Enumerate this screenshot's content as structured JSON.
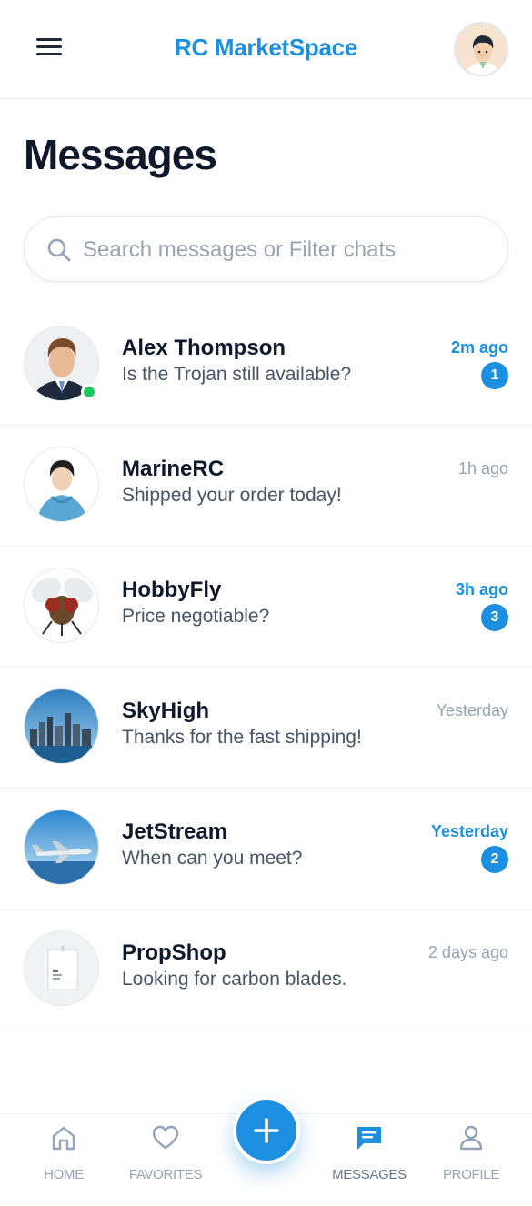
{
  "header": {
    "app_title": "RC MarketSpace"
  },
  "page": {
    "title": "Messages"
  },
  "search": {
    "placeholder": "Search messages or Filter chats",
    "value": ""
  },
  "chats": [
    {
      "name": "Alex Thompson",
      "message": "Is the Trojan still available?",
      "time": "2m ago",
      "unread": "1",
      "online": true
    },
    {
      "name": "MarineRC",
      "message": "Shipped your order today!",
      "time": "1h ago",
      "unread": ""
    },
    {
      "name": "HobbyFly",
      "message": "Price negotiable?",
      "time": "3h ago",
      "unread": "3"
    },
    {
      "name": "SkyHigh",
      "message": "Thanks for the fast shipping!",
      "time": "Yesterday",
      "unread": ""
    },
    {
      "name": "JetStream",
      "message": "When can you meet?",
      "time": "Yesterday",
      "unread": "2"
    },
    {
      "name": "PropShop",
      "message": "Looking for carbon blades.",
      "time": "2 days ago",
      "unread": ""
    }
  ],
  "bottom_nav": {
    "home": "HOME",
    "favorites": "FAVORITES",
    "messages": "MESSAGES",
    "profile": "PROFILE"
  },
  "colors": {
    "accent": "#1d8fe0",
    "online": "#22c55e",
    "text": "#0f172a",
    "muted": "#94a3b8"
  },
  "icons": {
    "menu": "hamburger-menu-icon",
    "search": "search-icon",
    "home": "home-icon",
    "favorites": "heart-icon",
    "add": "plus-icon",
    "messages": "chat-bubble-icon",
    "profile": "user-icon"
  }
}
